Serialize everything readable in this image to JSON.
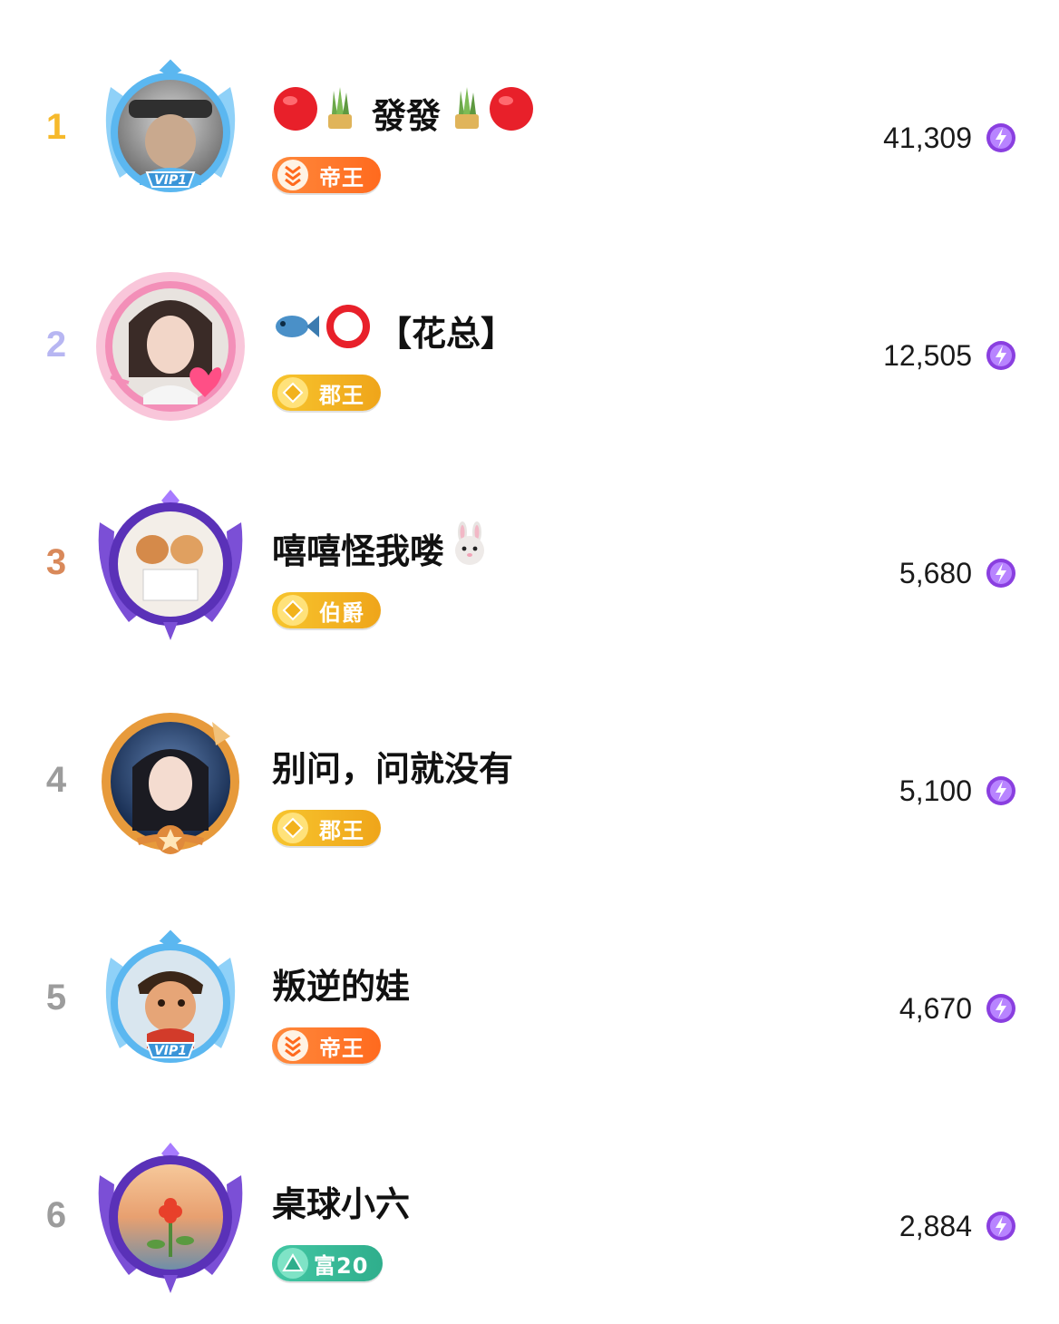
{
  "ranking": [
    {
      "rank": "1",
      "rank_color": "#F6B92B",
      "name": "發發",
      "name_icons": [
        "red-circle-icon",
        "kadomatsu-icon"
      ],
      "name_icons_after": [
        "kadomatsu-icon",
        "red-circle-icon"
      ],
      "avatar_frame": "vip-blue-frame",
      "frame_label": "VIP1",
      "badge": {
        "label": "帝王",
        "icon": "chevron-stack-icon",
        "color": "#FF7A2E"
      },
      "score": "41,309"
    },
    {
      "rank": "2",
      "rank_color": "#B7B6F2",
      "name": "【花总】",
      "name_icons": [
        "fish-icon",
        "hollow-red-circle-icon"
      ],
      "name_icons_after": [],
      "avatar_frame": "pink-heart-frame",
      "frame_label": "",
      "badge": {
        "label": "郡王",
        "icon": "diamond-coin-icon",
        "color": "#F2B21C"
      },
      "score": "12,505"
    },
    {
      "rank": "3",
      "rank_color": "#D9895A",
      "name": "嘻嘻怪我喽",
      "name_icons": [],
      "name_icons_after": [
        "rabbit-face-icon"
      ],
      "avatar_frame": "purple-winged-frame",
      "frame_label": "",
      "badge": {
        "label": "伯爵",
        "icon": "diamond-coin-icon",
        "color": "#F2B21C"
      },
      "score": "5,680"
    },
    {
      "rank": "4",
      "rank_color": "#9C9C9C",
      "name": "别问，问就没有",
      "name_icons": [],
      "name_icons_after": [],
      "avatar_frame": "gold-star-frame",
      "frame_label": "",
      "badge": {
        "label": "郡王",
        "icon": "diamond-coin-icon",
        "color": "#F2B21C"
      },
      "score": "5,100"
    },
    {
      "rank": "5",
      "rank_color": "#9C9C9C",
      "name": "叛逆的娃",
      "name_icons": [],
      "name_icons_after": [],
      "avatar_frame": "vip-blue-frame",
      "frame_label": "VIP1",
      "badge": {
        "label": "帝王",
        "icon": "chevron-stack-icon",
        "color": "#FF7A2E"
      },
      "score": "4,670"
    },
    {
      "rank": "6",
      "rank_color": "#9C9C9C",
      "name": "桌球小六",
      "name_icons": [],
      "name_icons_after": [],
      "avatar_frame": "purple-winged-frame",
      "frame_label": "",
      "badge": {
        "label": "富20",
        "icon": "triangle-gem-icon",
        "color": "#3DBB9B"
      },
      "score": "2,884"
    }
  ],
  "currency_icon": "lightning-coin-icon",
  "colors": {
    "vip_blue": "#5BB7F0",
    "pink_frame": "#F38FB8",
    "purple_frame": "#7B4FD6",
    "gold_frame": "#E79A3B",
    "bolt_purple": "#8A3FE0"
  }
}
